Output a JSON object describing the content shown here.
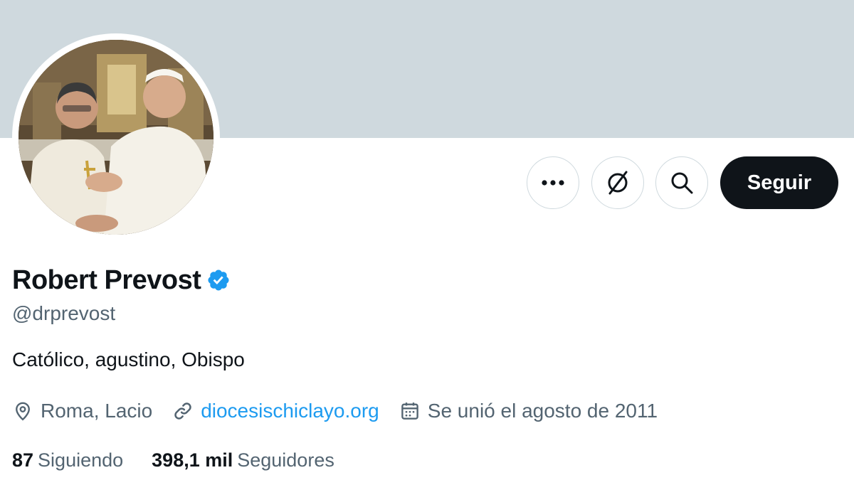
{
  "profile": {
    "name": "Robert Prevost",
    "handle": "@drprevost",
    "bio": "Católico, agustino, Obispo",
    "location": "Roma, Lacio",
    "website": "diocesischiclayo.org",
    "joined": "Se unió el agosto de 2011",
    "verified": true
  },
  "actions": {
    "more_icon": "more-horizontal-icon",
    "subscribe_icon": "circle-slash-icon",
    "search_icon": "search-icon",
    "follow_label": "Seguir"
  },
  "stats": {
    "following_count": "87",
    "following_label": "Siguiendo",
    "followers_count": "398,1 mil",
    "followers_label": "Seguidores"
  },
  "colors": {
    "banner": "#cfd9de",
    "primary_text": "#0f1419",
    "secondary_text": "#536471",
    "link": "#1d9bf0",
    "verified_badge": "#1d9bf0",
    "follow_button": "#0f1419"
  }
}
